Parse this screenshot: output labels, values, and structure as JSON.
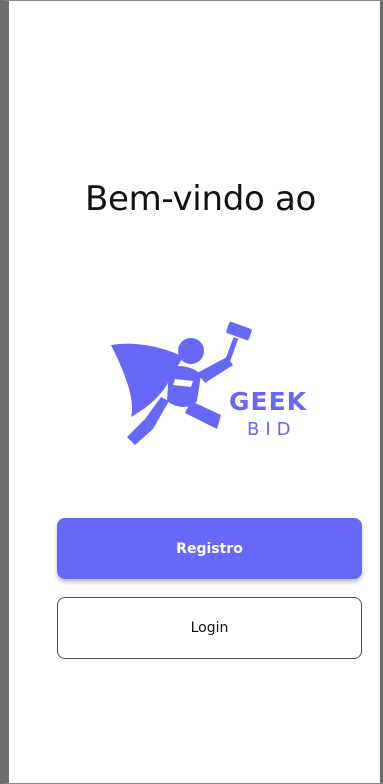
{
  "welcome": {
    "title": "Bem-vindo ao"
  },
  "logo": {
    "word_top": "GEEK",
    "word_bottom": "BID",
    "icon": "superhero-auction-hammer-icon"
  },
  "actions": {
    "register_label": "Registro",
    "login_label": "Login"
  },
  "colors": {
    "accent": "#6668f8",
    "text": "#111111",
    "frame": "#6e6e6e"
  }
}
